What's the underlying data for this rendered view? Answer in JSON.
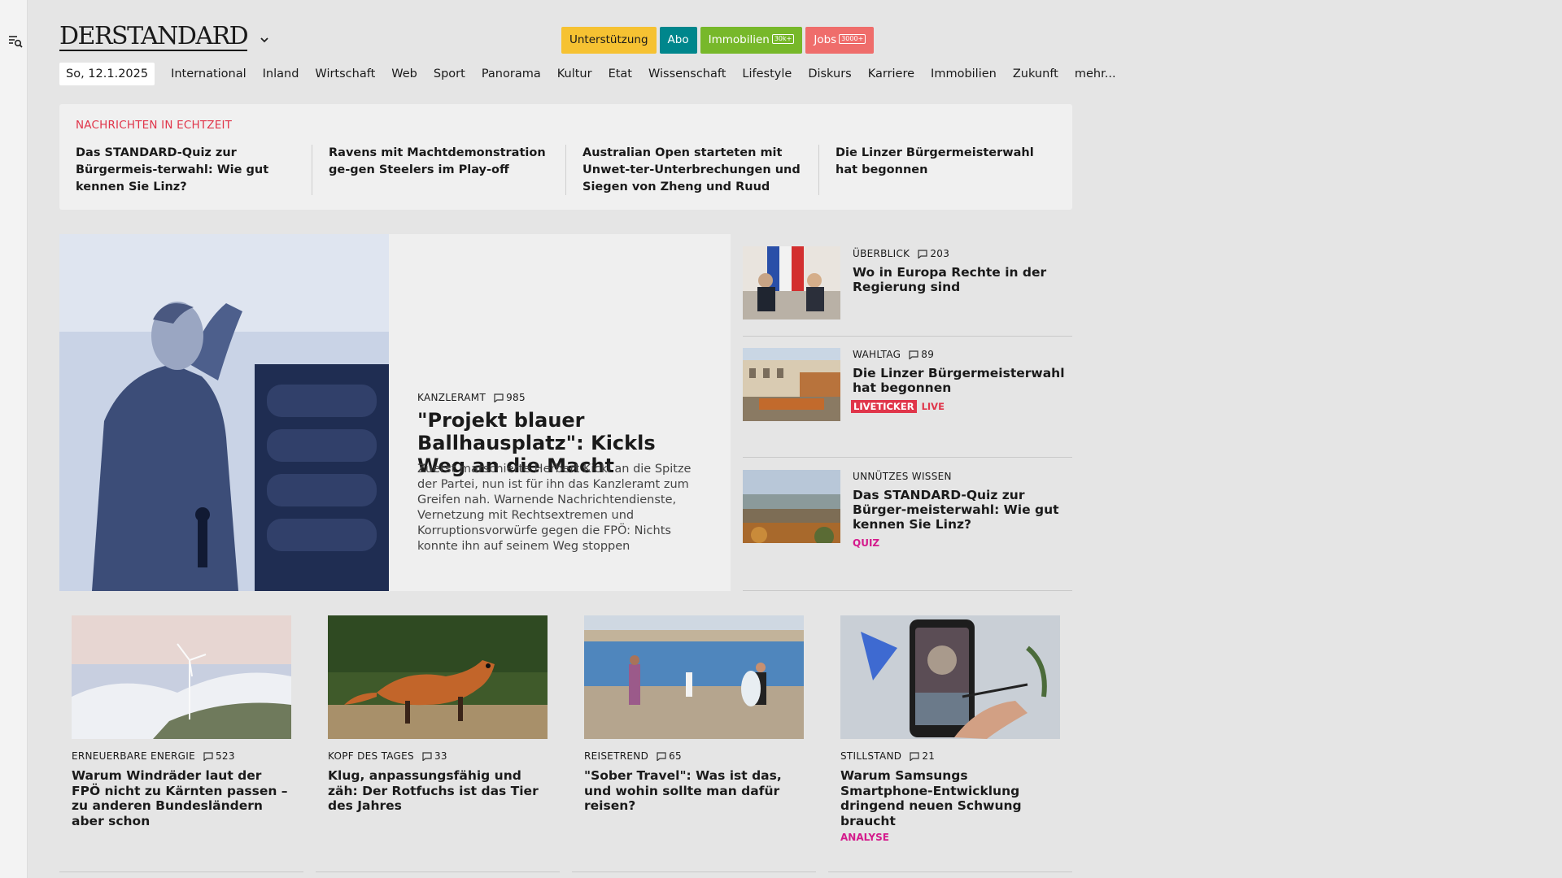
{
  "header": {
    "logo": "DERSTANDARD",
    "pills": [
      {
        "label": "Unterstützung",
        "badge": ""
      },
      {
        "label": "Abo",
        "badge": ""
      },
      {
        "label": "Immobilien",
        "badge": "30k+"
      },
      {
        "label": "Jobs",
        "badge": "3000+"
      }
    ]
  },
  "nav": {
    "date": "So, 12.1.2025",
    "items": [
      "International",
      "Inland",
      "Wirtschaft",
      "Web",
      "Sport",
      "Panorama",
      "Kultur",
      "Etat",
      "Wissenschaft",
      "Lifestyle",
      "Diskurs",
      "Karriere",
      "Immobilien",
      "Zukunft",
      "mehr..."
    ]
  },
  "live": {
    "title": "NACHRICHTEN IN ECHTZEIT",
    "items": [
      "Das STANDARD-Quiz zur Bürgermeis-terwahl: Wie gut kennen Sie Linz?",
      "Ravens mit Machtdemonstration ge-gen Steelers im Play-off",
      "Australian Open starteten mit Unwet-ter-Unterbrechungen und Siegen von Zheng und Ruud",
      "Die Linzer Bürgermeisterwahl hat begonnen"
    ]
  },
  "hero": {
    "kicker": "KANZLERAMT",
    "comments": "985",
    "title": "\"Projekt blauer Ballhausplatz\": Kickls Weg an die Macht",
    "teaser": "Zuerst marschierte Herbert Kickl an die Spitze der Partei, nun ist für ihn das Kanzleramt zum Greifen nah. Warnende Nachrichtendienste, Vernetzung mit Rechtsextremen und Korruptionsvorwürfe gegen die FPÖ: Nichts konnte ihn auf seinem Weg stoppen"
  },
  "side": [
    {
      "kicker": "ÜBERBLICK",
      "comments": "203",
      "title": "Wo in Europa Rechte in der Regierung sind"
    },
    {
      "kicker": "WAHLTAG",
      "comments": "89",
      "title": "Die Linzer Bürgermeisterwahl hat begonnen",
      "live_box": "LIVETICKER",
      "live_text": "LIVE"
    },
    {
      "kicker": "UNNÜTZES WISSEN",
      "comments": "",
      "title": "Das STANDARD-Quiz zur Bürger-meisterwahl: Wie gut kennen Sie Linz?",
      "tag": "QUIZ"
    }
  ],
  "cards": [
    {
      "kicker": "ERNEUERBARE ENERGIE",
      "comments": "523",
      "title": "Warum Windräder laut der FPÖ nicht zu Kärnten passen – zu anderen Bundesländern aber schon",
      "tag": ""
    },
    {
      "kicker": "KOPF DES TAGES",
      "comments": "33",
      "title": "Klug, anpassungsfähig und zäh: Der Rotfuchs ist das Tier des Jahres",
      "tag": ""
    },
    {
      "kicker": "REISETREND",
      "comments": "65",
      "title": "\"Sober Travel\": Was ist das, und wohin sollte man dafür reisen?",
      "tag": ""
    },
    {
      "kicker": "STILLSTAND",
      "comments": "21",
      "title": "Warum Samsungs Smartphone-Entwicklung dringend neuen Schwung braucht",
      "tag": "ANALYSE"
    }
  ],
  "colors": {
    "live_red": "#e0354a",
    "tag_magenta": "#d41a8c",
    "pill_yellow": "#f6c232",
    "pill_teal": "#00868c",
    "pill_green": "#77b82a",
    "pill_coral": "#ef6d6b"
  }
}
